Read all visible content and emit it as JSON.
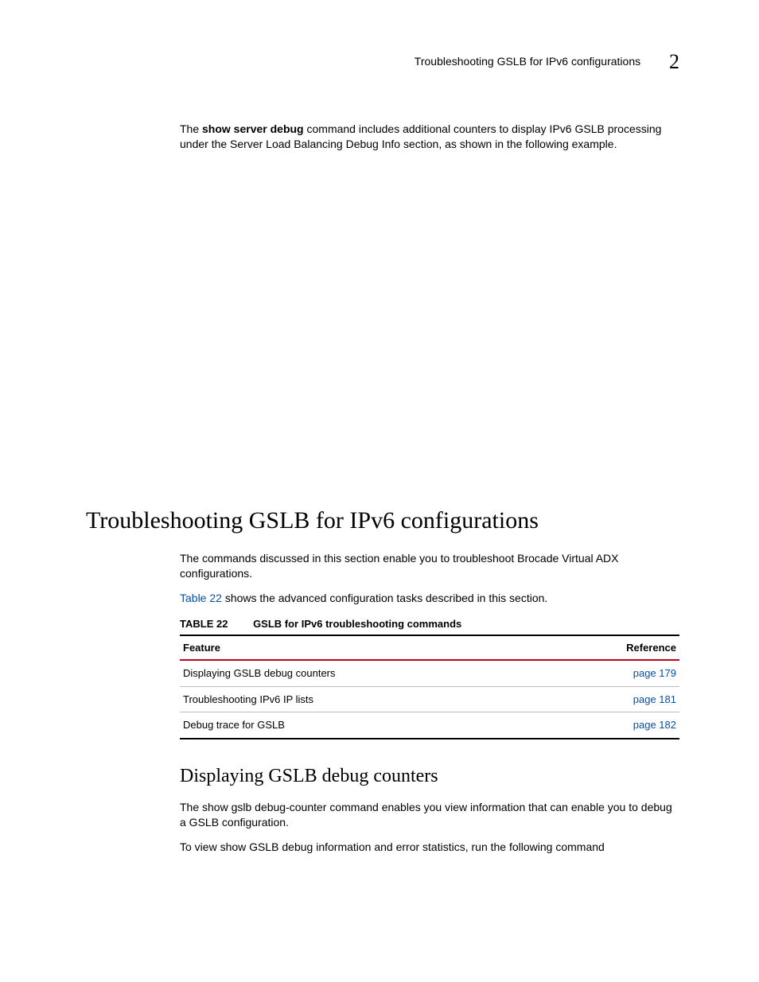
{
  "header": {
    "running_title": "Troubleshooting GSLB for IPv6 configurations",
    "chapter_number": "2"
  },
  "intro": {
    "pre": "The ",
    "command": "show server debug",
    "post": " command includes additional counters to display IPv6 GSLB processing under the Server Load Balancing Debug Info section, as shown in the following example."
  },
  "section": {
    "heading": "Troubleshooting GSLB for IPv6 configurations",
    "para1": "The commands discussed in this section enable you to troubleshoot Brocade Virtual ADX configurations.",
    "para2_link": "Table 22",
    "para2_rest": " shows the advanced configuration tasks described in this section."
  },
  "table": {
    "label": "TABLE 22",
    "caption": "GSLB for IPv6 troubleshooting commands",
    "head_feature": "Feature",
    "head_reference": "Reference",
    "rows": [
      {
        "feature": "Displaying GSLB debug counters",
        "ref": "page 179"
      },
      {
        "feature": "Troubleshooting IPv6 IP lists",
        "ref": "page 181"
      },
      {
        "feature": "Debug trace for GSLB",
        "ref": "page 182"
      }
    ]
  },
  "subsection": {
    "heading": "Displaying GSLB debug counters",
    "p1_pre": "The ",
    "p1_cmd": "show gslb debug-counter",
    "p1_post": " command enables you view information that can enable you to debug a GSLB configuration.",
    "p2": "To view show GSLB debug information and error statistics, run the following command"
  }
}
